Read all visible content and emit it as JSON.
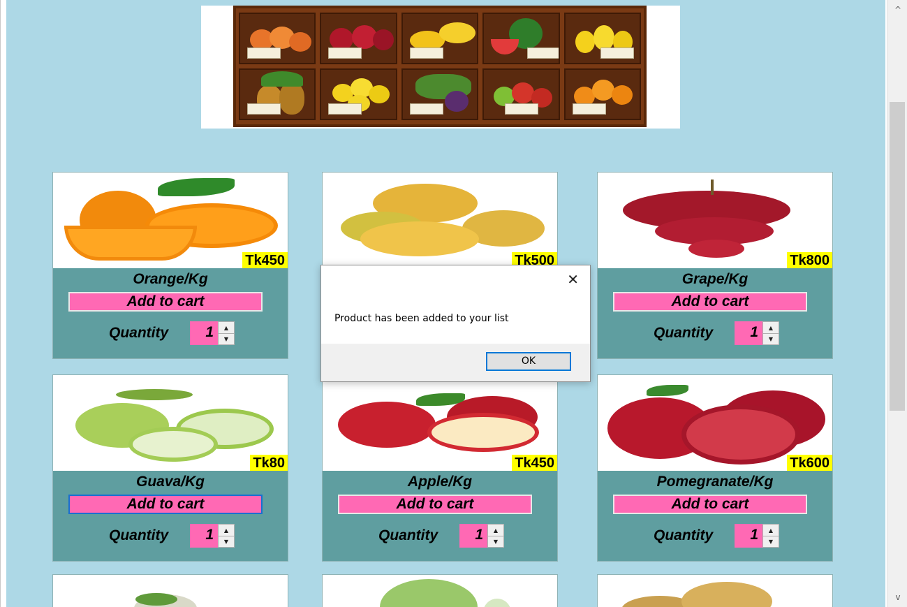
{
  "products": [
    {
      "name": "Orange/Kg",
      "price": "Tk450",
      "add_label": "Add to cart",
      "qty_label": "Quantity",
      "qty": "1"
    },
    {
      "name": "",
      "price": "Tk500",
      "add_label": "",
      "qty_label": "",
      "qty": ""
    },
    {
      "name": "Grape/Kg",
      "price": "Tk800",
      "add_label": "Add to cart",
      "qty_label": "Quantity",
      "qty": "1"
    },
    {
      "name": "Guava/Kg",
      "price": "Tk80",
      "add_label": "Add to cart",
      "qty_label": "Quantity",
      "qty": "1"
    },
    {
      "name": "Apple/Kg",
      "price": "Tk450",
      "add_label": "Add to cart",
      "qty_label": "Quantity",
      "qty": "1"
    },
    {
      "name": "Pomegranate/Kg",
      "price": "Tk600",
      "add_label": "Add to cart",
      "qty_label": "Quantity",
      "qty": "1"
    }
  ],
  "dialog": {
    "message": "Product has been added to your list",
    "ok_label": "OK",
    "close_glyph": "✕"
  },
  "scrollbar": {
    "up_glyph": "^",
    "down_glyph": "v"
  },
  "colors": {
    "background": "#add8e6",
    "card": "#5f9ea0",
    "button": "#ff69b4",
    "price_tag": "#ffff00"
  }
}
